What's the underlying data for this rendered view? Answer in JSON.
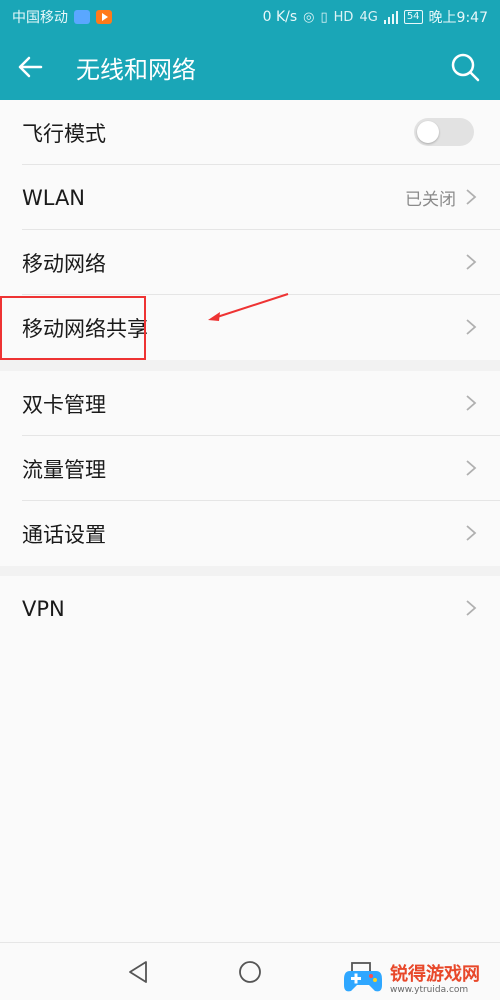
{
  "status_bar": {
    "carrier": "中国移动",
    "net_speed": "0 K/s",
    "network_type": "4G",
    "hd_label": "HD",
    "battery": "54",
    "time": "晚上9:47"
  },
  "app_bar": {
    "title": "无线和网络"
  },
  "groups": [
    {
      "items": [
        {
          "label": "飞行模式",
          "type": "toggle",
          "state": "off"
        },
        {
          "label": "WLAN",
          "type": "link",
          "value": "已关闭"
        },
        {
          "label": "移动网络",
          "type": "link"
        },
        {
          "label": "移动网络共享",
          "type": "link",
          "highlighted": true
        }
      ]
    },
    {
      "items": [
        {
          "label": "双卡管理",
          "type": "link"
        },
        {
          "label": "流量管理",
          "type": "link"
        },
        {
          "label": "通话设置",
          "type": "link"
        }
      ]
    },
    {
      "items": [
        {
          "label": "VPN",
          "type": "link"
        }
      ]
    }
  ],
  "watermark": {
    "name": "锐得游戏网",
    "url": "www.ytruida.com"
  },
  "colors": {
    "accent": "#1aa6b7",
    "annotation": "#e33333"
  }
}
